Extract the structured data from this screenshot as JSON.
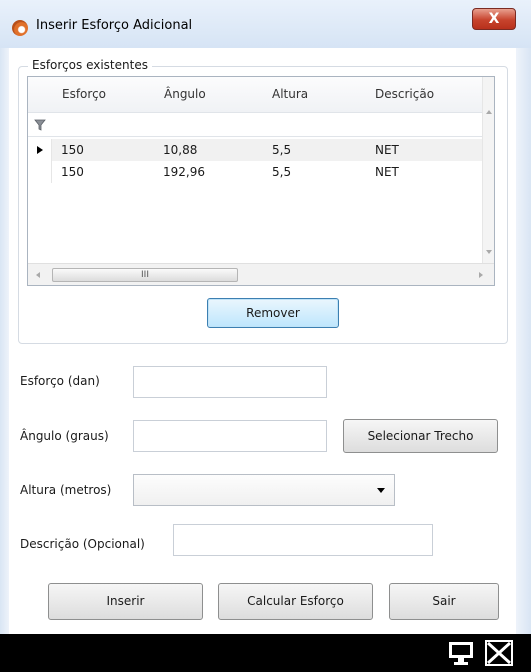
{
  "window": {
    "title": "Inserir Esforço Adicional",
    "close_glyph": "X"
  },
  "group": {
    "legend": "Esforços existentes"
  },
  "grid": {
    "columns": [
      "Esforço",
      "Ângulo",
      "Altura",
      "Descrição"
    ],
    "rows": [
      [
        "150",
        "10,88",
        "5,5",
        "NET"
      ],
      [
        "150",
        "192,96",
        "5,5",
        "NET"
      ]
    ],
    "selected_row": 0,
    "hscroll_glyph": "III"
  },
  "buttons": {
    "remover": "Remover",
    "selecionar_trecho": "Selecionar Trecho",
    "inserir": "Inserir",
    "calcular": "Calcular Esforço",
    "sair": "Sair"
  },
  "form": {
    "esforco": {
      "label": "Esforço (dan)",
      "value": ""
    },
    "angulo": {
      "label": "Ângulo (graus)",
      "value": ""
    },
    "altura": {
      "label": "Altura (metros)",
      "value": ""
    },
    "descricao": {
      "label": "Descrição (Opcional)",
      "value": ""
    }
  },
  "icons": [
    "app-icon",
    "filter-icon",
    "row-pointer-icon",
    "dropdown-arrow-icon",
    "monitor-icon",
    "close-x-icon"
  ],
  "colors": {
    "close_button": "#c7432d",
    "focus_border": "#3c7fb1",
    "taskbar": "#000000"
  }
}
